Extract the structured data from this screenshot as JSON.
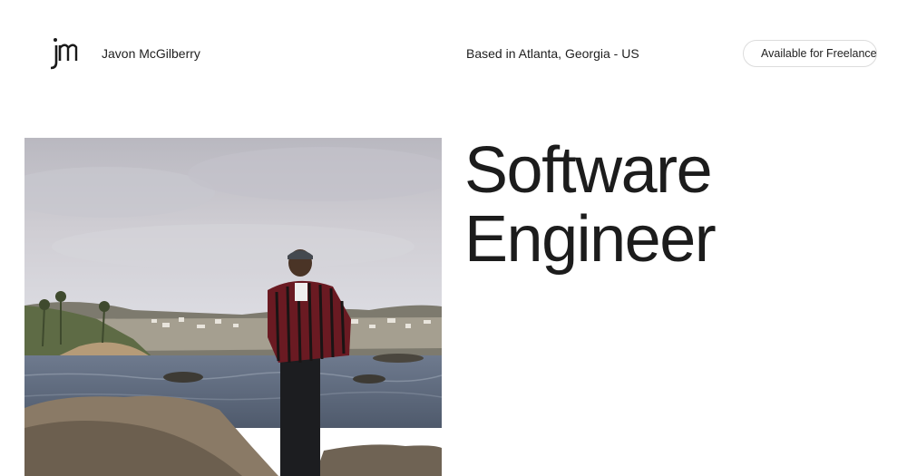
{
  "header": {
    "logo_icon": "jm-monogram-icon",
    "name": "Javon McGilberry",
    "location": "Based in Atlanta, Georgia - US",
    "availability": {
      "label": "Available for Freelance",
      "dot_color": "#3a9b4b"
    }
  },
  "hero": {
    "photo_icon": "portrait-photo",
    "headline_line1": "Software",
    "headline_line2": "Engineer"
  }
}
